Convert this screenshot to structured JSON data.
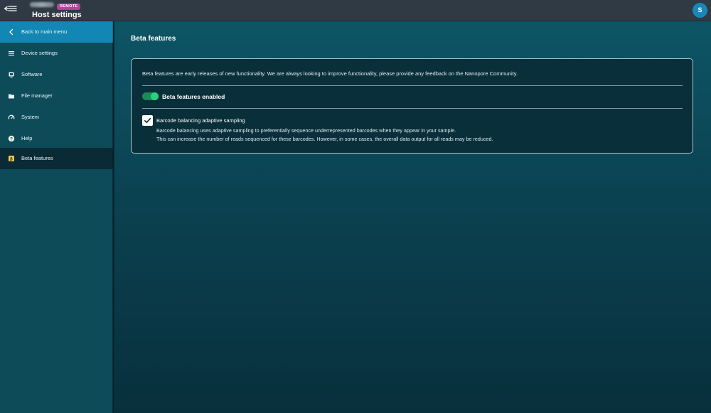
{
  "header": {
    "host_name": "",
    "remote_badge": "REMOTE",
    "title": "Host settings",
    "avatar_initial": "S",
    "menu_icon": "menu-collapse-icon"
  },
  "sidebar": {
    "items": [
      {
        "label": "Back to main menu",
        "icon": "chevron-left-icon"
      },
      {
        "label": "Device settings",
        "icon": "list-icon"
      },
      {
        "label": "Software",
        "icon": "monitor-icon"
      },
      {
        "label": "File manager",
        "icon": "folder-icon"
      },
      {
        "label": "System",
        "icon": "gauge-icon"
      },
      {
        "label": "Help",
        "icon": "help-icon"
      },
      {
        "label": "Beta features",
        "icon": "beta-icon"
      }
    ],
    "active_index": 6
  },
  "main": {
    "title": "Beta features",
    "intro": "Beta features are early releases of new functionality. We are always looking to improve functionality, please provide any feedback on the Nanopore Community.",
    "toggle": {
      "label": "Beta features enabled",
      "on": true
    },
    "feature": {
      "title": "Barcode balancing adaptive sampling",
      "checked": true,
      "description_line1": "Barcode balancing uses adaptive sampling to preferentially sequence underrepresented barcodes when they appear in your sample.",
      "description_line2": "This can increase the number of reads sequenced for these barcodes. However, in some cases, the overall data output for all reads may be reduced."
    }
  },
  "colors": {
    "accent": "#1287b4",
    "toggle_on": "#2fcf7e",
    "badge": "#b4439b",
    "beta_icon": "#f2c94c"
  }
}
